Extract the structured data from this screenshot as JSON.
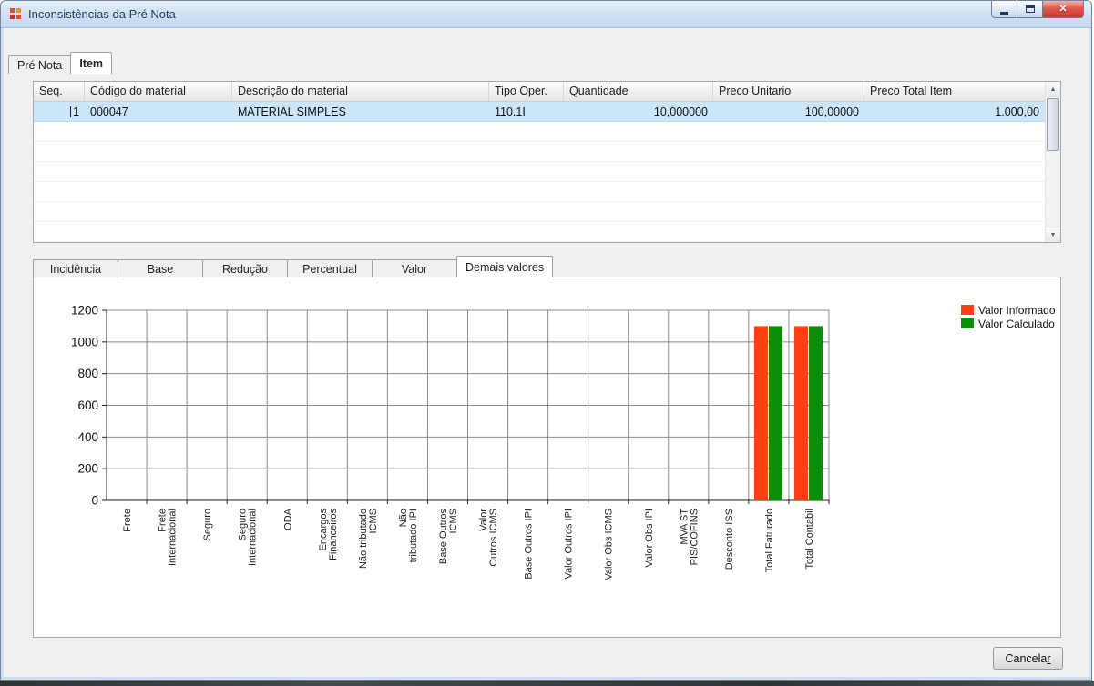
{
  "window": {
    "title": "Inconsistências da Pré Nota"
  },
  "top_tabs": [
    {
      "label": "Pré Nota",
      "active": false
    },
    {
      "label": "Item",
      "active": true
    }
  ],
  "grid": {
    "columns": [
      "Seq.",
      "Código do material",
      "Descrição do material",
      "Tipo Oper.",
      "Quantidade",
      "Preco Unitario",
      "Preco Total Item"
    ],
    "rows": [
      {
        "selected": true,
        "cells": [
          "1",
          "000047",
          "MATERIAL SIMPLES",
          "110.1I",
          "10,000000",
          "100,00000",
          "1.000,00"
        ]
      }
    ]
  },
  "value_tabs": [
    {
      "label": "Incidência",
      "active": false
    },
    {
      "label": "Base",
      "active": false
    },
    {
      "label": "Redução",
      "active": false
    },
    {
      "label": "Percentual",
      "active": false
    },
    {
      "label": "Valor",
      "active": false
    },
    {
      "label": "Demais valores",
      "active": true
    }
  ],
  "chart_data": {
    "type": "bar",
    "categories": [
      "Frete",
      "Frete\nInternacional",
      "Seguro",
      "Seguro\nInternacional",
      "ODA",
      "Encargos\nFinanceiros",
      "Não tributado\nICMS",
      "Não\ntributado IPI",
      "Base Outros\nICMS",
      "Valor\nOutros ICMS",
      "Base Outros IPI",
      "Valor Outros IPI",
      "Valor Obs ICMS",
      "Valor Obs IPI",
      "MVA ST\nPIS/COFINS",
      "Desconto ISS",
      "Total Faturado",
      "Total Contabil"
    ],
    "series": [
      {
        "name": "Valor Informado",
        "color": "#ff4013",
        "values": [
          0,
          0,
          0,
          0,
          0,
          0,
          0,
          0,
          0,
          0,
          0,
          0,
          0,
          0,
          0,
          0,
          1100,
          1100
        ]
      },
      {
        "name": "Valor Calculado",
        "color": "#0b8f0b",
        "values": [
          0,
          0,
          0,
          0,
          0,
          0,
          0,
          0,
          0,
          0,
          0,
          0,
          0,
          0,
          0,
          0,
          1100,
          1100
        ]
      }
    ],
    "title": "",
    "xlabel": "",
    "ylabel": "",
    "ylim": [
      0,
      1200
    ],
    "yticks": [
      0,
      200,
      400,
      600,
      800,
      1000,
      1200
    ],
    "grid": true,
    "legend_position": "right"
  },
  "footer": {
    "cancel_label": "Cancelar",
    "mnemonic": "r"
  }
}
